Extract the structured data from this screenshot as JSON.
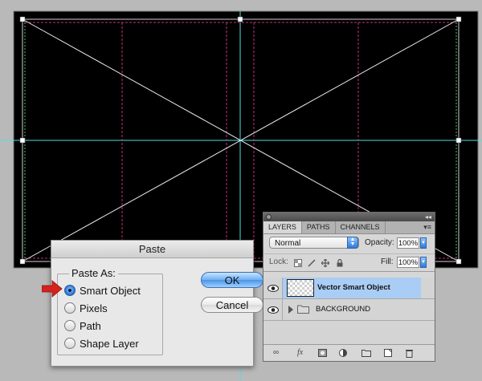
{
  "canvas": {
    "background": "#000000",
    "guide_pink": "#c0327a",
    "guide_cyan": "#55dce4",
    "guide_green": "#4fbf6a",
    "cross_lines": "#e8e8e8"
  },
  "dialog": {
    "title": "Paste",
    "group_label": "Paste As:",
    "options": [
      {
        "label": "Smart Object",
        "checked": true
      },
      {
        "label": "Pixels",
        "checked": false
      },
      {
        "label": "Path",
        "checked": false
      },
      {
        "label": "Shape Layer",
        "checked": false
      }
    ],
    "ok_label": "OK",
    "cancel_label": "Cancel",
    "arrow_color": "#d6211c"
  },
  "panel": {
    "tabs": [
      "LAYERS",
      "PATHS",
      "CHANNELS"
    ],
    "active_tab": "LAYERS",
    "blend_mode": "Normal",
    "opacity_label": "Opacity:",
    "opacity_value": "100%",
    "lock_label": "Lock:",
    "fill_label": "Fill:",
    "fill_value": "100%",
    "layers": [
      {
        "name": "Vector Smart Object",
        "selected": true,
        "visible": true
      },
      {
        "name": "BACKGROUND",
        "selected": false,
        "visible": true,
        "group": true
      }
    ],
    "bottom_icons": [
      "link-icon",
      "fx-icon",
      "mask-icon",
      "adjustment-icon",
      "folder-icon",
      "new-layer-icon",
      "trash-icon"
    ]
  }
}
